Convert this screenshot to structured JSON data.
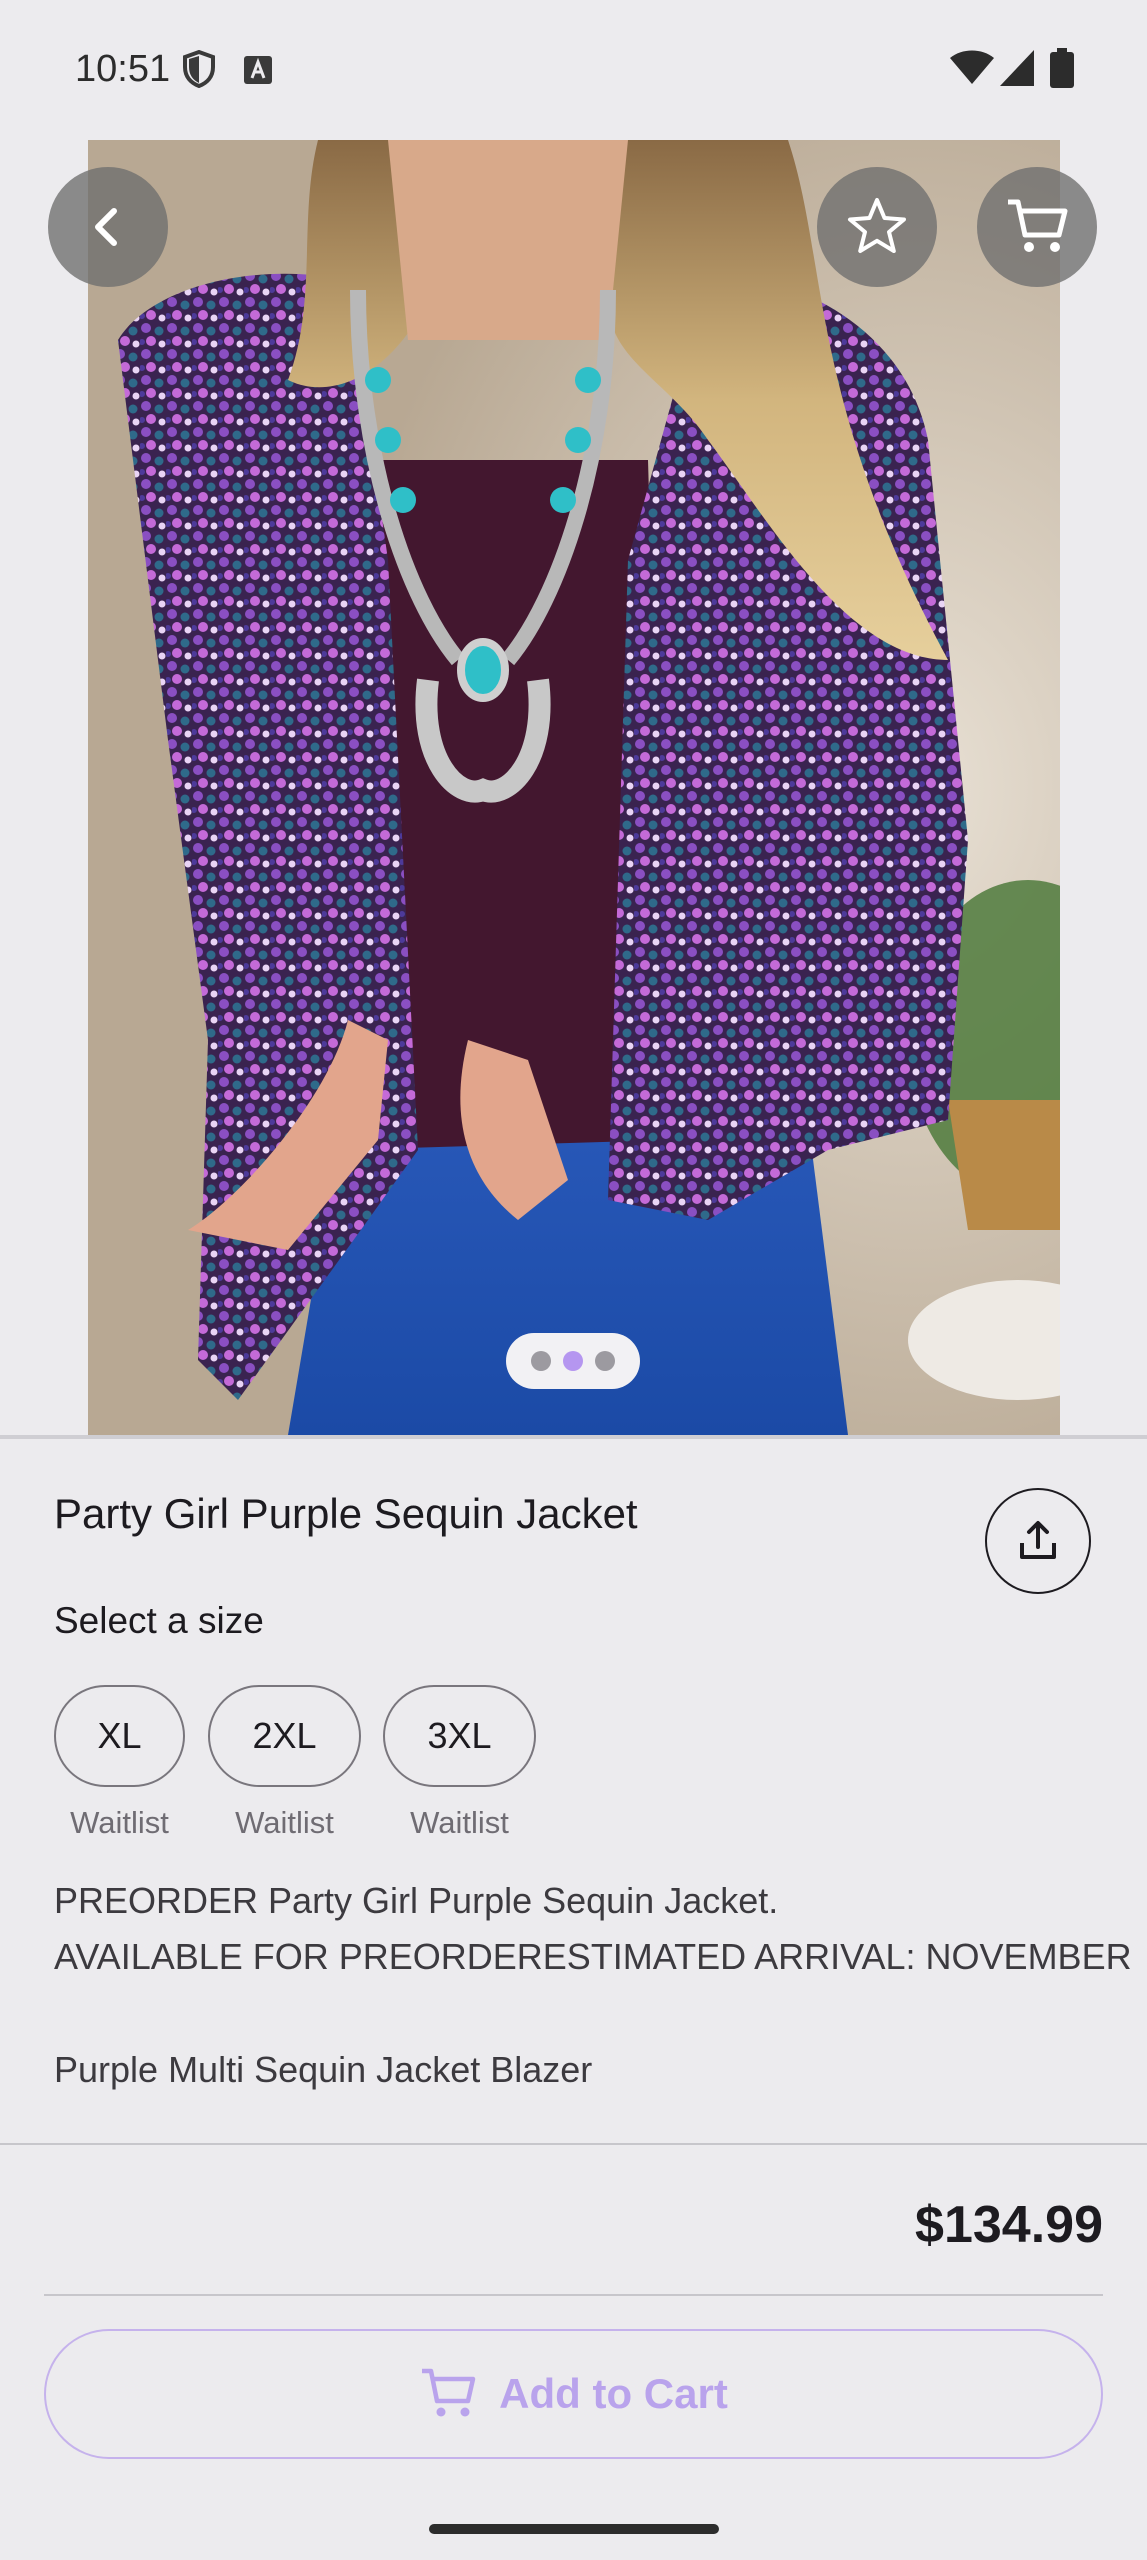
{
  "status_bar": {
    "time": "10:51",
    "icons": [
      "shield-icon",
      "font-a-icon",
      "wifi-icon",
      "signal-icon",
      "battery-icon"
    ]
  },
  "hero": {
    "image_alt": "Woman wearing purple sequin jacket with turquoise squash blossom necklace",
    "carousel": {
      "count": 3,
      "active_index": 1
    },
    "buttons": [
      "back-arrow-icon",
      "star-icon",
      "cart-icon"
    ]
  },
  "product": {
    "title": "Party Girl Purple Sequin Jacket",
    "select_size_label": "Select a size",
    "sizes": [
      {
        "label": "XL",
        "status": "Waitlist"
      },
      {
        "label": "2XL",
        "status": "Waitlist"
      },
      {
        "label": "3XL",
        "status": "Waitlist"
      }
    ],
    "description_lines": [
      "PREORDER Party Girl Purple Sequin Jacket.",
      "AVAILABLE FOR PREORDERESTIMATED ARRIVAL: NOVEMBER",
      "Purple Multi Sequin Jacket Blazer"
    ]
  },
  "footer": {
    "price": "$134.99",
    "add_to_cart_label": "Add to Cart"
  },
  "colors": {
    "background": "#ECEBEE",
    "accent": "#B9A3EC",
    "text": "#1D1B20"
  }
}
